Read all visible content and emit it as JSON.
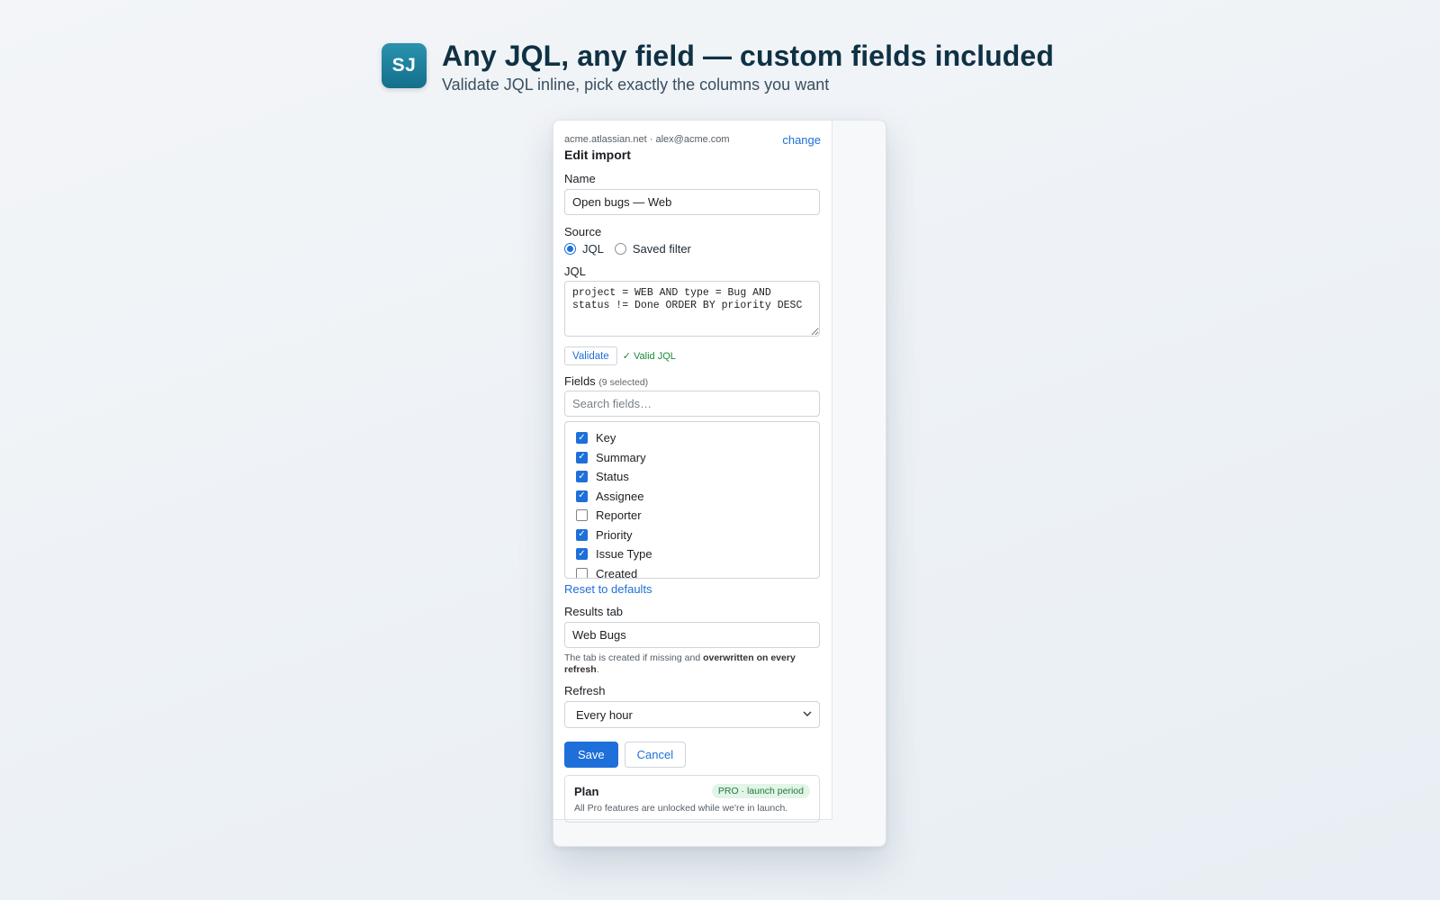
{
  "hero": {
    "logo_text": "SJ",
    "title": "Any JQL, any field — custom fields included",
    "subtitle": "Validate JQL inline, pick exactly the columns you want"
  },
  "panel": {
    "account": "acme.atlassian.net · alex@acme.com",
    "change_label": "change",
    "title": "Edit import",
    "name": {
      "label": "Name",
      "value": "Open bugs — Web"
    },
    "source": {
      "label": "Source",
      "options": [
        {
          "label": "JQL",
          "selected": true
        },
        {
          "label": "Saved filter",
          "selected": false
        }
      ]
    },
    "jql": {
      "label": "JQL",
      "value": "project = WEB AND type = Bug AND status != Done ORDER BY priority DESC",
      "validate_label": "Validate",
      "status": "✓ Valid JQL"
    },
    "fields": {
      "label": "Fields",
      "count": "(9 selected)",
      "search_placeholder": "Search fields…",
      "items": [
        {
          "label": "Key",
          "checked": true
        },
        {
          "label": "Summary",
          "checked": true
        },
        {
          "label": "Status",
          "checked": true
        },
        {
          "label": "Assignee",
          "checked": true
        },
        {
          "label": "Reporter",
          "checked": false
        },
        {
          "label": "Priority",
          "checked": true
        },
        {
          "label": "Issue Type",
          "checked": true
        },
        {
          "label": "Created",
          "checked": false
        }
      ],
      "reset_label": "Reset to defaults"
    },
    "results_tab": {
      "label": "Results tab",
      "value": "Web Bugs",
      "help_prefix": "The tab is created if missing and ",
      "help_bold": "overwritten on every refresh",
      "help_suffix": "."
    },
    "refresh": {
      "label": "Refresh",
      "value": "Every hour"
    },
    "save_label": "Save",
    "cancel_label": "Cancel",
    "plan": {
      "title": "Plan",
      "badge": "PRO · launch period",
      "note": "All Pro features are unlocked while we're in launch."
    }
  },
  "colors": {
    "accent": "#1e6fd9",
    "logo": "#1a7f9c",
    "valid": "#1a8a3a",
    "badge_bg": "#e3f4e8",
    "badge_text": "#1f7a3a"
  },
  "icons": {
    "refresh_select": "chevron-down-icon",
    "checkbox_on": "check-icon"
  }
}
